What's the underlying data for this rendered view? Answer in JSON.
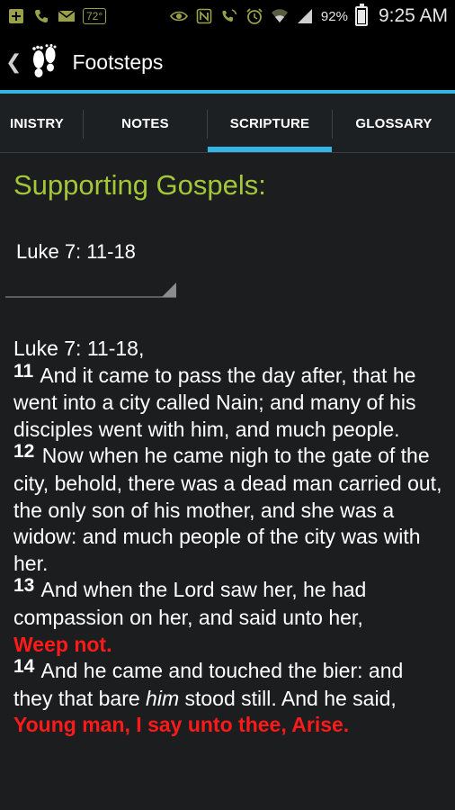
{
  "status_bar": {
    "temperature": "72°",
    "battery_percent": "92%",
    "time": "9:25 AM",
    "battery_level": 0.92,
    "icons": [
      "add-icon",
      "phone-icon",
      "mail-icon",
      "temperature-icon",
      "eye-icon",
      "nfc-icon",
      "wifi-calling-icon",
      "alarm-icon",
      "wifi-icon",
      "signal-icon",
      "battery-icon"
    ]
  },
  "action_bar": {
    "title": "Footsteps",
    "icons": [
      "up-caret-icon",
      "footprints-icon"
    ]
  },
  "tabs": [
    {
      "label": "INISTRY",
      "selected": false
    },
    {
      "label": "NOTES",
      "selected": false
    },
    {
      "label": "SCRIPTURE",
      "selected": true
    },
    {
      "label": "GLOSSARY",
      "selected": false
    }
  ],
  "content": {
    "section_title": "Supporting Gospels:",
    "spinner_value": "Luke 7: 11-18",
    "passage_heading": "Luke 7: 11-18,",
    "verses": [
      {
        "number": "11",
        "text": "And it came to pass the day after, that he went into a city called Nain; and many of his disciples went with him, and much people."
      },
      {
        "number": "12",
        "text": "Now when he came nigh to the gate of the city, behold, there was a dead man carried out, the only son of his mother, and she was a widow: and much people of the city was with her."
      },
      {
        "number": "13",
        "text": "And when the Lord saw her, he had compassion on her, and said unto her,",
        "red": "Weep not."
      },
      {
        "number": "14",
        "text_a": "And he came and touched the bier: and they that bare",
        "italic": "him",
        "text_b": "stood still. And he said,",
        "red": "Young man, I say unto thee, Arise."
      }
    ]
  },
  "colors": {
    "accent": "#33b5e5",
    "title_green": "#a4c639",
    "words_of_christ": "#ff1a1a",
    "status_icon": "#9aa04a"
  }
}
